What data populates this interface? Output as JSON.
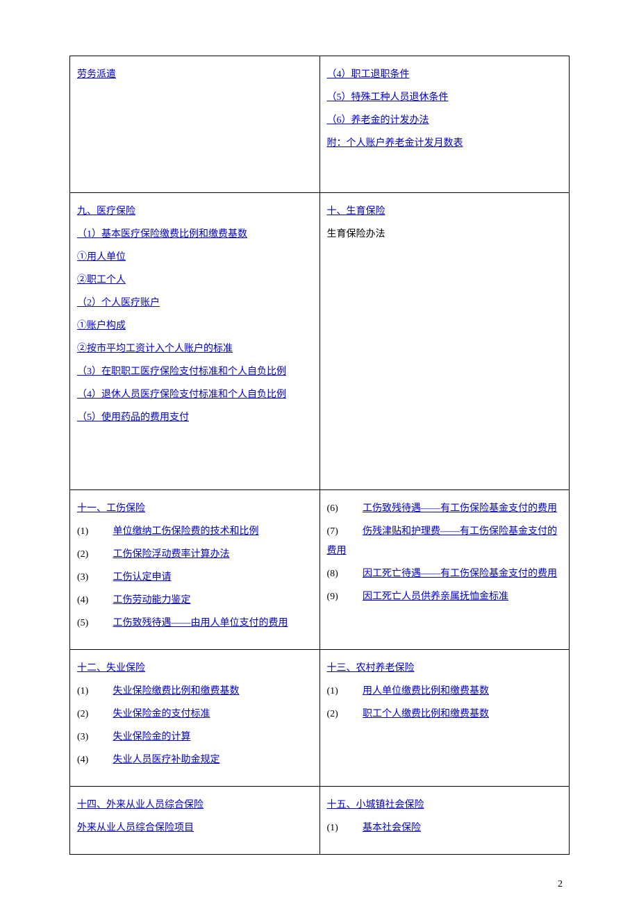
{
  "row1": {
    "left": {
      "items": [
        {
          "text": "劳务派遣",
          "link": true
        }
      ]
    },
    "right": {
      "items": [
        {
          "text": "（4）职工退职条件",
          "link": true
        },
        {
          "text": "（5）特殊工种人员退休条件",
          "link": true
        },
        {
          "text": "（6）养老金的计发办法",
          "link": true
        },
        {
          "text": "附：个人账户养老金计发月数表",
          "link": true
        }
      ]
    }
  },
  "row2": {
    "left": {
      "title": "九、医疗保险",
      "items": [
        {
          "text": "（1）基本医疗保险缴费比例和缴费基数",
          "link": true
        },
        {
          "text": "①用人单位",
          "link": true
        },
        {
          "text": "②职工个人",
          "link": true
        },
        {
          "text": "（2）个人医疗账户",
          "link": true
        },
        {
          "text": "①账户构成",
          "link": true
        },
        {
          "text": "②按市平均工资计入个人账户的标准",
          "link": true
        },
        {
          "text": "（3）在职职工医疗保险支付标准和个人自负比例",
          "link": true
        },
        {
          "text": "（4）退休人员医疗保险支付标准和个人自负比例",
          "link": true
        },
        {
          "text": "（5）使用药品的费用支付",
          "link": true
        }
      ]
    },
    "right": {
      "title": "十、生育保险",
      "items": [
        {
          "text": "生育保险办法",
          "link": false
        }
      ]
    }
  },
  "row3": {
    "left": {
      "title": "十一、工伤保险",
      "items": [
        {
          "num": "(1)",
          "text": "单位缴纳工伤保险费的技术和比例"
        },
        {
          "num": "(2)",
          "text": "工伤保险浮动费率计算办法"
        },
        {
          "num": "(3)",
          "text": "工伤认定申请"
        },
        {
          "num": "(4)",
          "text": "工伤劳动能力鉴定"
        },
        {
          "num": "(5)",
          "text": "工伤致残待遇——由用人单位支付的费用"
        }
      ]
    },
    "right": {
      "items": [
        {
          "num": "(6)",
          "text": "工伤致残待遇——有工伤保险基金支付的费用"
        },
        {
          "num": "(7)",
          "text": "伤残津贴和护理费——有工伤保险基金支付的费用"
        },
        {
          "num": "(8)",
          "text": "因工死亡待遇——有工伤保险基金支付的费用"
        },
        {
          "num": "(9)",
          "text": "因工死亡人员供养亲属抚恤金标准"
        }
      ]
    }
  },
  "row4": {
    "left": {
      "title": "十二、失业保险",
      "items": [
        {
          "num": "(1)",
          "text": "失业保险缴费比例和缴费基数"
        },
        {
          "num": "(2)",
          "text": "失业保险金的支付标准"
        },
        {
          "num": "(3)",
          "text": "失业保险金的计算"
        },
        {
          "num": "(4)",
          "text": "失业人员医疗补助金规定"
        }
      ]
    },
    "right": {
      "title": "十三、农村养老保险",
      "items": [
        {
          "num": "(1)",
          "text": "用人单位缴费比例和缴费基数"
        },
        {
          "num": "(2)",
          "text": "职工个人缴费比例和缴费基数"
        }
      ]
    }
  },
  "row5": {
    "left": {
      "title": "十四、外来从业人员综合保险",
      "items": [
        {
          "text": "外来从业人员综合保险项目",
          "link": true
        }
      ]
    },
    "right": {
      "title": "十五、小城镇社会保险",
      "items": [
        {
          "num": "(1)",
          "text": "基本社会保险"
        }
      ]
    }
  },
  "pagenum": "2"
}
